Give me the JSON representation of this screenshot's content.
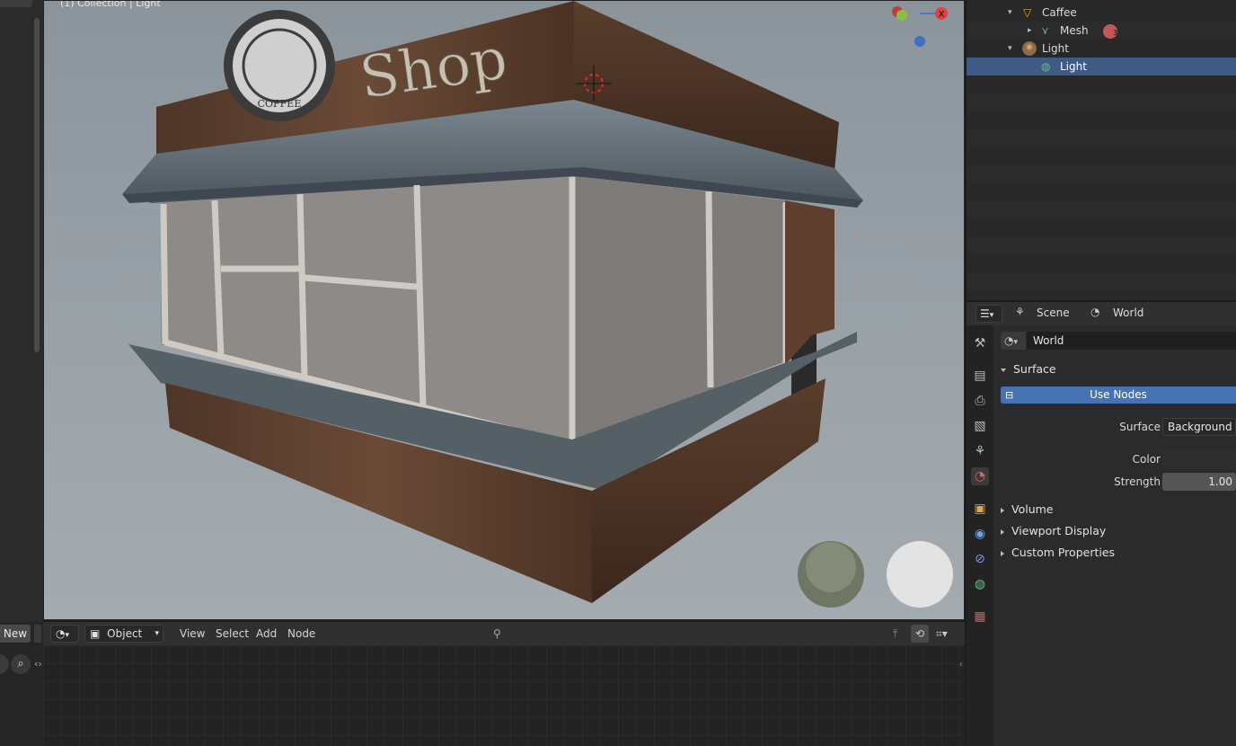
{
  "viewport": {
    "info_text": "(1) Collection | Light",
    "shop_sign": "Shop",
    "coffee_sign": "COFFEE",
    "gizmo_x_label": "X"
  },
  "node_editor": {
    "new_button": "New",
    "mode": "Object",
    "menus": [
      "View",
      "Select",
      "Add",
      "Node"
    ]
  },
  "outliner": {
    "rows": [
      {
        "label": "Caffee",
        "indent": 1
      },
      {
        "label": "Mesh",
        "indent": 2
      },
      {
        "label": "Light",
        "indent": 1
      },
      {
        "label": "Light",
        "indent": 2
      }
    ],
    "mesh_badge": "3"
  },
  "properties": {
    "breadcrumb_scene": "Scene",
    "breadcrumb_world": "World",
    "world_name": "World",
    "surface_panel": "Surface",
    "use_nodes_label": "Use Nodes",
    "surface_label": "Surface",
    "surface_value": "Background",
    "color_label": "Color",
    "strength_label": "Strength",
    "strength_value": "1.00",
    "collapsed_panels": [
      "Volume",
      "Viewport Display",
      "Custom Properties"
    ]
  },
  "colors": {
    "selection": "#3f5a85",
    "use_nodes": "#4772b3",
    "accent_orange": "#e5a44a",
    "accent_green": "#5fc37a"
  }
}
